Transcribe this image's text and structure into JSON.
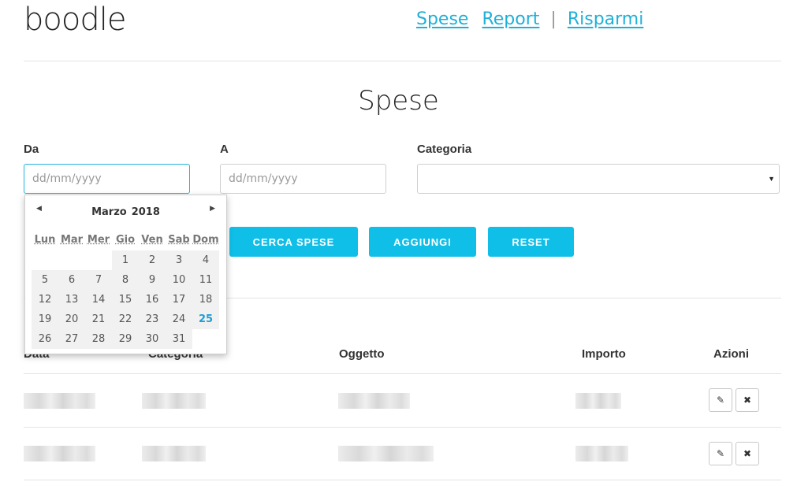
{
  "brand": "boodle",
  "nav": {
    "spese": "Spese",
    "report": "Report",
    "separator": "|",
    "risparmi": "Risparmi"
  },
  "page_title": "Spese",
  "filters": {
    "da_label": "Da",
    "da_placeholder": "dd/mm/yyyy",
    "a_label": "A",
    "a_placeholder": "dd/mm/yyyy",
    "categoria_label": "Categoria",
    "categoria_value": ""
  },
  "buttons": {
    "cerca": "CERCA SPESE",
    "aggiungi": "AGGIUNGI",
    "reset": "RESET"
  },
  "calendar": {
    "month": "Marzo",
    "year": "2018",
    "weekdays": [
      "Lun",
      "Mar",
      "Mer",
      "Gio",
      "Ven",
      "Sab",
      "Dom"
    ],
    "leading_empty_days": 3,
    "days_in_month": 31,
    "today": 25,
    "prev_icon": "triangle-left-icon",
    "next_icon": "triangle-right-icon"
  },
  "table": {
    "headers": [
      "Data",
      "Categoria",
      "Oggetto",
      "Importo",
      "Azioni"
    ],
    "rows_count": 2,
    "edit_icon": "pencil-icon",
    "delete_icon": "close-icon"
  },
  "colors": {
    "accent": "#10bfe8",
    "link": "#1fb0d8",
    "today": "#1d9ed6"
  }
}
